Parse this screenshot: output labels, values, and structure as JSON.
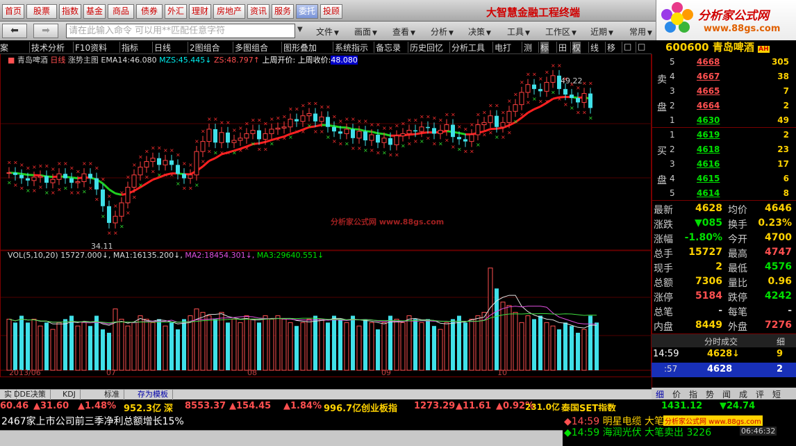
{
  "toolbar": {
    "buttons": [
      "首页",
      "股票",
      "指数",
      "基金",
      "商品",
      "债券",
      "外汇",
      "理财",
      "房地产",
      "资讯",
      "服务",
      "委托",
      "投顾"
    ],
    "selected": "委托",
    "brand": "大智慧金融工程终端"
  },
  "logo": {
    "title": "分析家公式网",
    "url": "www.88gs.com"
  },
  "row2": {
    "back_icon": "back-arrow-icon",
    "forward_icon": "forward-arrow-icon",
    "cmd_placeholder": "请在此输入命令  可以用**匹配任意字符",
    "menus": [
      "文件",
      "画面",
      "查看",
      "分析",
      "决策",
      "工具",
      "工作区",
      "近期",
      "常用"
    ]
  },
  "row3": {
    "items": [
      "案",
      "技术分析",
      "F10资料",
      "指标",
      "日线",
      "2图组合",
      "多图组合",
      "图形叠加",
      "系统指示",
      "备忘录",
      "历史回忆",
      "分析工具",
      "电打",
      "测",
      "标",
      "田",
      "权",
      "线",
      "移",
      "□",
      "□",
      "▪"
    ]
  },
  "stock": {
    "code": "600600",
    "name": "青岛啤酒",
    "badge": "AH"
  },
  "chart_header": {
    "name": "青岛啤酒",
    "period": "日线",
    "main": "涨势主图",
    "ema_label": "EMA14:",
    "ema_val": "46.080",
    "mzs_label": "MZS:",
    "mzs_val": "45.445",
    "zs_label": "ZS:",
    "zs_val": "48.797",
    "lastweek_open": "上周开价:",
    "lastweek_close": "上周收价:",
    "lastweek_close_val": "48.080"
  },
  "annotations": {
    "high": "49.22",
    "low": "34.11",
    "watermark": "分析家公式网  www.88gs.com"
  },
  "vol_header": {
    "label": "VOL(5,10,20)",
    "vol": "15727.000",
    "ma1_label": "MA1:",
    "ma1": "16135.200",
    "ma2_label": "MA2:",
    "ma2": "18454.301",
    "ma3_label": "MA3:",
    "ma3": "29640.551"
  },
  "dates": [
    "2013/06",
    "07",
    "08",
    "09",
    "10"
  ],
  "orderbook": {
    "sell_label": [
      "卖",
      "盘"
    ],
    "buy_label": [
      "买",
      "盘"
    ],
    "asks": [
      {
        "level": "5",
        "price": "4668",
        "vol": "305"
      },
      {
        "level": "4",
        "price": "4667",
        "vol": "38"
      },
      {
        "level": "3",
        "price": "4665",
        "vol": "7"
      },
      {
        "level": "2",
        "price": "4664",
        "vol": "2"
      },
      {
        "level": "1",
        "price": "4630",
        "vol": "49"
      }
    ],
    "bids": [
      {
        "level": "1",
        "price": "4619",
        "vol": "2"
      },
      {
        "level": "2",
        "price": "4618",
        "vol": "23"
      },
      {
        "level": "3",
        "price": "4616",
        "vol": "17"
      },
      {
        "level": "4",
        "price": "4615",
        "vol": "6"
      },
      {
        "level": "5",
        "price": "4614",
        "vol": "8"
      }
    ]
  },
  "stats": [
    {
      "k1": "最新",
      "v1": "4628",
      "c1": "#ffd200",
      "k2": "均价",
      "v2": "4646",
      "c2": "#ffd200"
    },
    {
      "k1": "涨跌",
      "v1": "▼085",
      "c1": "#00e000",
      "k2": "换手",
      "v2": "0.23%",
      "c2": "#ffd200"
    },
    {
      "k1": "涨幅",
      "v1": "-1.80%",
      "c1": "#00e000",
      "k2": "今开",
      "v2": "4700",
      "c2": "#ffd200"
    },
    {
      "k1": "总手",
      "v1": "15727",
      "c1": "#ffd200",
      "k2": "最高",
      "v2": "4747",
      "c2": "#ff5050"
    },
    {
      "k1": "现手",
      "v1": "2",
      "c1": "#ffd200",
      "k2": "最低",
      "v2": "4576",
      "c2": "#00e000"
    },
    {
      "k1": "总额",
      "v1": "7306",
      "c1": "#ffd200",
      "k2": "量比",
      "v2": "0.96",
      "c2": "#ffd200"
    },
    {
      "k1": "涨停",
      "v1": "5184",
      "c1": "#ff5050",
      "k2": "跌停",
      "v2": "4242",
      "c2": "#00e000"
    },
    {
      "k1": "总笔",
      "v1": "-",
      "c1": "#ccc",
      "k2": "每笔",
      "v2": "-",
      "c2": "#ccc"
    },
    {
      "k1": "内盘",
      "v1": "8449",
      "c1": "#ffd200",
      "k2": "外盘",
      "v2": "7276",
      "c2": "#ff5050"
    }
  ],
  "ticks": {
    "title": "分时成交",
    "detail": "细",
    "rows": [
      {
        "time": "14:59",
        "price": "4628↓",
        "vol": "9"
      },
      {
        "time": ":57",
        "price": "4628",
        "vol": "2"
      }
    ]
  },
  "bottom_tabs": [
    "实",
    "DDE决策",
    "KDJ",
    "标准",
    "存为模板"
  ],
  "right_tabs": [
    "细",
    "价",
    "指",
    "势",
    "闻",
    "成",
    "评",
    "短"
  ],
  "index_ticker": {
    "a": "60.46",
    "b": "▲31.60",
    "c": "▲1.48%",
    "d": "952.3亿",
    "e": "深",
    "f": "8553.37",
    "g": "▲154.45",
    "h": "▲1.84%",
    "i": "996.7亿",
    "j": "创业板指",
    "k": "1273.29",
    "l": "▲11.61",
    "m": "▲0.92%",
    "n": "231.0亿",
    "o": "泰国SET指数",
    "p": "1431.12",
    "q": "▼24.74"
  },
  "news": "2467家上市公司前三季净利总额增长15%",
  "alerts": [
    {
      "time": "◆14:59",
      "text": "明星电缆 大笔..."
    },
    {
      "time": "◆14:59",
      "text": "海润光伏 大笔卖出 3226"
    }
  ],
  "watermark2": "分析家公式网 www.88gs.com",
  "clock": "06:46:32",
  "chart_data": {
    "type": "candlestick",
    "ema14_last": 46.08,
    "high_label": 49.22,
    "low_label": 34.11,
    "series": [
      {
        "name": "price_close",
        "values": [
          40.5,
          40.3,
          40.0,
          39.8,
          40.1,
          40.2,
          39.6,
          39.9,
          40.4,
          40.0,
          39.6,
          39.7,
          40.4,
          40.0,
          39.0,
          37.5,
          36.0,
          36.6,
          37.8,
          39.2,
          40.3,
          41.0,
          41.5,
          41.8,
          41.2,
          41.6,
          41.2,
          40.4,
          40.0,
          40.3,
          42.4,
          43.3,
          44.4,
          43.2,
          44.1,
          43.2,
          43.4,
          43.6,
          44.0,
          44.3,
          43.5,
          44.0,
          44.4,
          44.5,
          44.6,
          45.3,
          45.1,
          45.6,
          45.8,
          45.1,
          45.5,
          44.6,
          44.2,
          44.0,
          44.4,
          43.6,
          44.2,
          43.4,
          43.9,
          43.2,
          43.6,
          43.0,
          43.8,
          44.0,
          44.3,
          44.2,
          44.6,
          44.5,
          44.0,
          44.3,
          44.8,
          43.7,
          43.5,
          43.3,
          43.9,
          44.8,
          45.0,
          45.6,
          44.6,
          45.0,
          46.0,
          46.6,
          47.7,
          48.4,
          48.0,
          47.8,
          48.6,
          49.2,
          48.0,
          47.5,
          47.2,
          46.8,
          47.6,
          46.3
        ]
      },
      {
        "name": "volume",
        "values": [
          15,
          14,
          16,
          14,
          15,
          13,
          14,
          12,
          14,
          15,
          16,
          13,
          14,
          13,
          16,
          12,
          11,
          18,
          15,
          13,
          14,
          16,
          15,
          14,
          15,
          13,
          14,
          12,
          15,
          16,
          18,
          17,
          16,
          15,
          17,
          14,
          15,
          14,
          16,
          15,
          14,
          16,
          15,
          16,
          15,
          14,
          13,
          14,
          15,
          16,
          15,
          14,
          16,
          15,
          14,
          16,
          13,
          15,
          14,
          12,
          14,
          16,
          15,
          14,
          16,
          15,
          14,
          15,
          13,
          12,
          14,
          15,
          16,
          14,
          15,
          16,
          17,
          30,
          24,
          20,
          19,
          17,
          14,
          16,
          15,
          16,
          14,
          13,
          12,
          14,
          13,
          11,
          12,
          16,
          14
        ]
      }
    ]
  }
}
